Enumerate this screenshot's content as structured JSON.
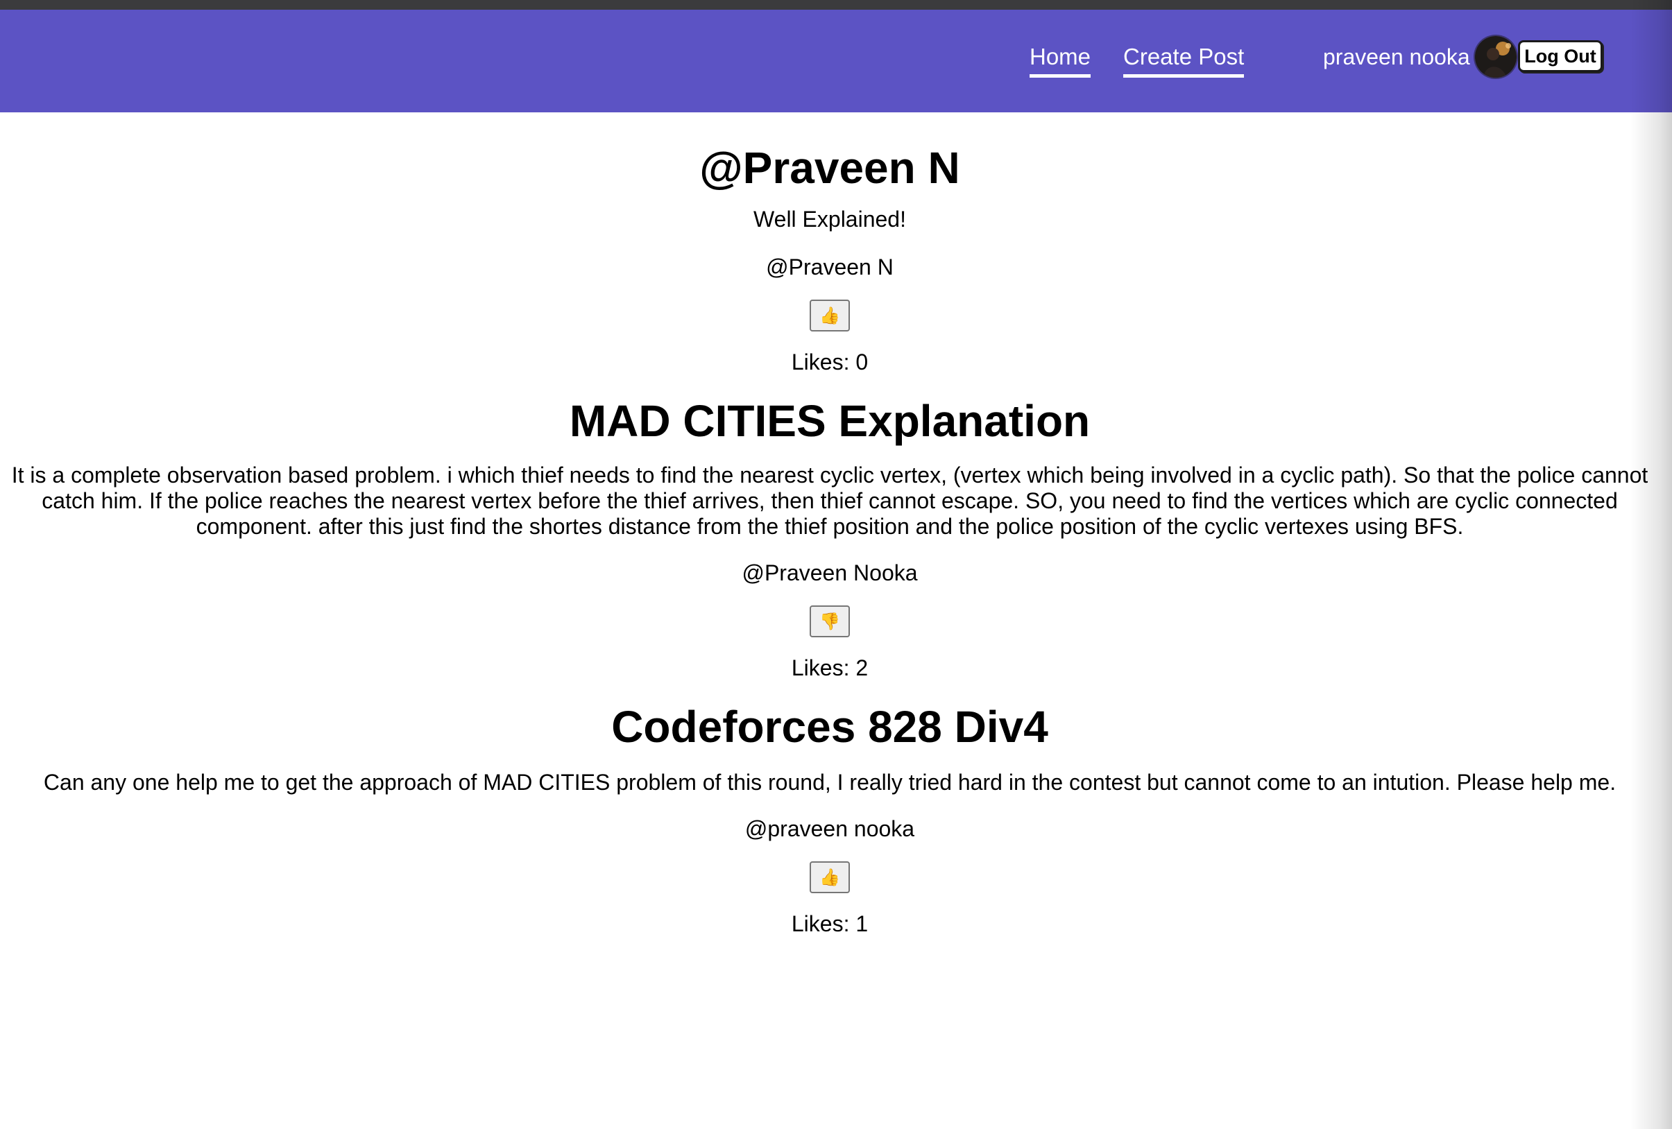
{
  "nav": {
    "home_label": "Home",
    "create_post_label": "Create Post",
    "user_name": "praveen nooka",
    "logout_label": "Log Out"
  },
  "posts": [
    {
      "title": "@Praveen N",
      "body": "Well Explained!",
      "author": "@Praveen N",
      "like_icon": "thumbs-up-icon",
      "like_glyph": "👍",
      "likes_text": "Likes: 0"
    },
    {
      "title": "MAD CITIES Explanation",
      "body": "It is a complete observation based problem. i which thief needs to find the nearest cyclic vertex, (vertex which being involved in a cyclic path). So that the police cannot catch him. If the police reaches the nearest vertex before the thief arrives, then thief cannot escape. SO, you need to find the vertices which are cyclic connected component. after this just find the shortes distance from the thief position and the police position of the cyclic vertexes using BFS.",
      "author": "@Praveen Nooka",
      "like_icon": "thumbs-down-icon",
      "like_glyph": "👎",
      "likes_text": "Likes: 2"
    },
    {
      "title": "Codeforces 828 Div4",
      "body": "Can any one help me to get the approach of MAD CITIES problem of this round, I really tried hard in the contest but cannot come to an intution. Please help me.",
      "author": "@praveen nooka",
      "like_icon": "thumbs-up-icon",
      "like_glyph": "👍",
      "likes_text": "Likes: 1"
    }
  ],
  "colors": {
    "navbar": "#5c53c4",
    "top_strip": "#3b3b3d",
    "nav_text": "#ffffff"
  }
}
